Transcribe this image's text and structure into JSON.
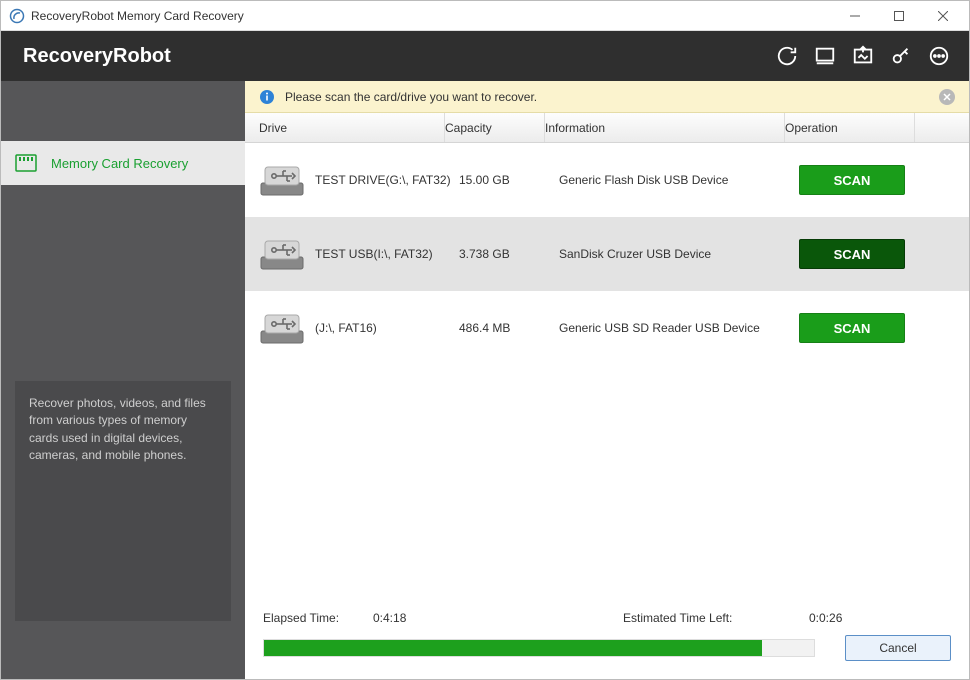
{
  "window": {
    "title": "RecoveryRobot Memory Card Recovery"
  },
  "header": {
    "brand": "RecoveryRobot"
  },
  "sidebar": {
    "nav_label": "Memory Card Recovery",
    "description": "Recover photos, videos, and files from various types of memory cards used in digital devices, cameras, and mobile phones."
  },
  "infobar": {
    "text": "Please scan the card/drive you want to recover."
  },
  "columns": {
    "drive": "Drive",
    "capacity": "Capacity",
    "info": "Information",
    "op": "Operation"
  },
  "drives": [
    {
      "name": "TEST DRIVE(G:\\, FAT32)",
      "capacity": "15.00 GB",
      "info": "Generic  Flash Disk  USB Device",
      "button": "SCAN",
      "selected": false
    },
    {
      "name": "TEST USB(I:\\, FAT32)",
      "capacity": "3.738 GB",
      "info": "SanDisk  Cruzer  USB Device",
      "button": "SCAN",
      "selected": true
    },
    {
      "name": "(J:\\, FAT16)",
      "capacity": "486.4 MB",
      "info": "Generic  USB SD Reader  USB Device",
      "button": "SCAN",
      "selected": false
    }
  ],
  "footer": {
    "elapsed_label": "Elapsed Time:",
    "elapsed_value": "0:4:18",
    "eta_label": "Estimated Time Left:",
    "eta_value": "0:0:26",
    "cancel": "Cancel",
    "progress_pct": 90.6
  }
}
